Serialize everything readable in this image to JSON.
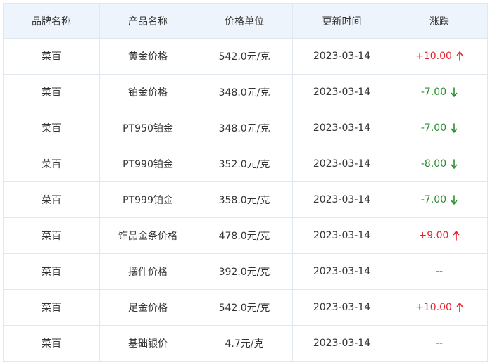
{
  "table": {
    "headers": [
      "品牌名称",
      "产品名称",
      "价格单位",
      "更新时间",
      "涨跌"
    ],
    "rows": [
      {
        "brand": "菜百",
        "product": "黄金价格",
        "price": "542.0元/克",
        "date": "2023-03-14",
        "change": "+10.00",
        "direction": "up"
      },
      {
        "brand": "菜百",
        "product": "铂金价格",
        "price": "348.0元/克",
        "date": "2023-03-14",
        "change": "-7.00",
        "direction": "down"
      },
      {
        "brand": "菜百",
        "product": "PT950铂金",
        "price": "348.0元/克",
        "date": "2023-03-14",
        "change": "-7.00",
        "direction": "down"
      },
      {
        "brand": "菜百",
        "product": "PT990铂金",
        "price": "352.0元/克",
        "date": "2023-03-14",
        "change": "-8.00",
        "direction": "down"
      },
      {
        "brand": "菜百",
        "product": "PT999铂金",
        "price": "358.0元/克",
        "date": "2023-03-14",
        "change": "-7.00",
        "direction": "down"
      },
      {
        "brand": "菜百",
        "product": "饰品金条价格",
        "price": "478.0元/克",
        "date": "2023-03-14",
        "change": "+9.00",
        "direction": "up"
      },
      {
        "brand": "菜百",
        "product": "摆件价格",
        "price": "392.0元/克",
        "date": "2023-03-14",
        "change": "--",
        "direction": "flat"
      },
      {
        "brand": "菜百",
        "product": "足金价格",
        "price": "542.0元/克",
        "date": "2023-03-14",
        "change": "+10.00",
        "direction": "up"
      },
      {
        "brand": "菜百",
        "product": "基础银价",
        "price": "4.7元/克",
        "date": "2023-03-14",
        "change": "--",
        "direction": "flat"
      }
    ]
  },
  "icons": {
    "up": "arrow-up-icon",
    "down": "arrow-down-icon"
  },
  "colors": {
    "up": "#e8232d",
    "down": "#2a8f2f",
    "header_bg": "#eef4fc",
    "border": "#dfe8f1"
  }
}
